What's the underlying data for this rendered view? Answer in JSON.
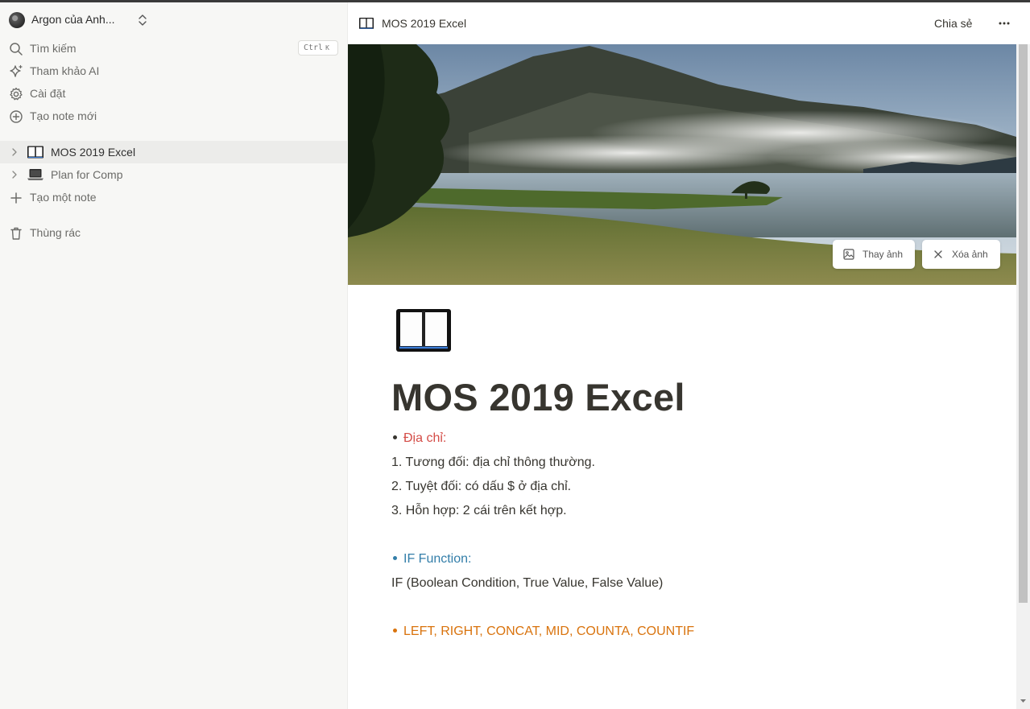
{
  "sidebar": {
    "workspace_name": "Argon của Anh...",
    "nav": [
      {
        "label": "Tìm kiếm",
        "icon": "search-icon"
      },
      {
        "label": "Tham khảo AI",
        "icon": "sparkle-icon"
      },
      {
        "label": "Cài đặt",
        "icon": "gear-icon"
      },
      {
        "label": "Tạo note mới",
        "icon": "plus-circle-icon"
      }
    ],
    "search_shortcut": "Ctrl",
    "search_shortcut_key": "K",
    "pages": [
      {
        "label": "MOS 2019 Excel",
        "icon": "open-book-icon",
        "active": true
      },
      {
        "label": "Plan for Comp",
        "icon": "laptop-icon",
        "active": false
      }
    ],
    "add_page_label": "Tạo một note",
    "trash_label": "Thùng rác"
  },
  "topbar": {
    "breadcrumb": "MOS 2019 Excel",
    "share_label": "Chia sẻ",
    "more_icon": "more-horizontal-icon"
  },
  "cover": {
    "change_label": "Thay ảnh",
    "remove_label": "Xóa ảnh"
  },
  "document": {
    "icon": "open-book-icon",
    "title": "MOS 2019 Excel",
    "section1_heading": "Địa chỉ:",
    "section1_items": [
      "1.  Tương đối: địa chỉ thông thường.",
      "2.  Tuyệt đối: có dấu $ ở địa chỉ.",
      "3.  Hỗn hợp: 2 cái trên kết hợp."
    ],
    "section2_heading": "IF Function:",
    "section2_text": "IF (Boolean Condition, True Value, False Value)",
    "section3_heading": "LEFT, RIGHT, CONCAT, MID, COUNTA, COUNTIF"
  },
  "colors": {
    "red": "#d44c47",
    "blue": "#337ea9",
    "orange": "#d9730d",
    "sidebar_bg": "#f7f7f5"
  }
}
